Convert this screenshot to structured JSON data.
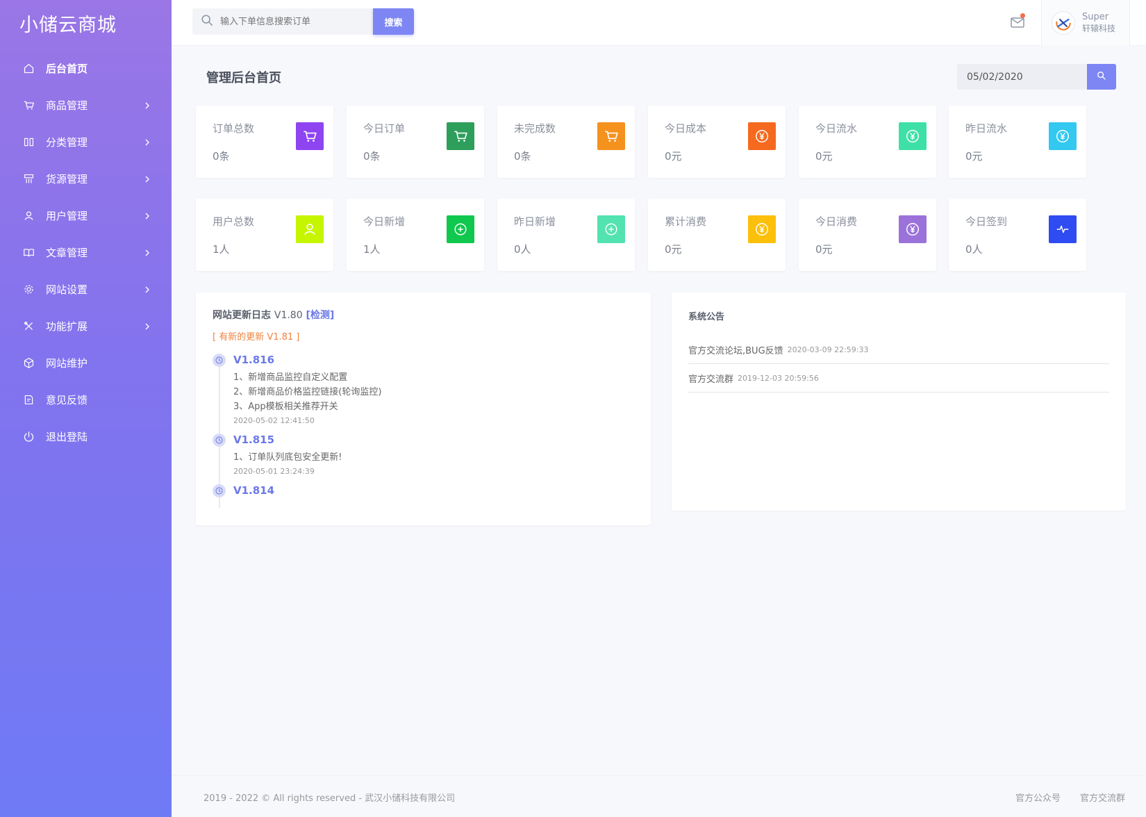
{
  "sidebar": {
    "brand": "小储云商城",
    "items": [
      {
        "label": "后台首页",
        "icon": "home-icon",
        "chevron": false
      },
      {
        "label": "商品管理",
        "icon": "cart-icon",
        "chevron": true
      },
      {
        "label": "分类管理",
        "icon": "columns-icon",
        "chevron": true
      },
      {
        "label": "货源管理",
        "icon": "grid-icon",
        "chevron": true
      },
      {
        "label": "用户管理",
        "icon": "user-icon",
        "chevron": true
      },
      {
        "label": "文章管理",
        "icon": "book-icon",
        "chevron": true
      },
      {
        "label": "网站设置",
        "icon": "gear-icon",
        "chevron": true
      },
      {
        "label": "功能扩展",
        "icon": "tools-icon",
        "chevron": true
      },
      {
        "label": "网站维护",
        "icon": "cube-icon",
        "chevron": false
      },
      {
        "label": "意见反馈",
        "icon": "feedback-icon",
        "chevron": false
      },
      {
        "label": "退出登陆",
        "icon": "power-icon",
        "chevron": false
      }
    ]
  },
  "header": {
    "search_placeholder": "输入下单信息搜索订单",
    "search_button": "搜索",
    "user_name": "Super",
    "user_org": "轩辕科技"
  },
  "main": {
    "title": "管理后台首页",
    "date": "05/02/2020",
    "stats": [
      {
        "label": "订单总数",
        "value": "0条",
        "icon": "cart-icon",
        "color": "#8e44f0"
      },
      {
        "label": "今日订单",
        "value": "0条",
        "icon": "cart-icon",
        "color": "#2e9e5b"
      },
      {
        "label": "未完成数",
        "value": "0条",
        "icon": "cart-icon",
        "color": "#f5921e"
      },
      {
        "label": "今日成本",
        "value": "0元",
        "icon": "yen-icon",
        "color": "#f56a1f"
      },
      {
        "label": "今日流水",
        "value": "0元",
        "icon": "yen-icon",
        "color": "#3fe0a8"
      },
      {
        "label": "昨日流水",
        "value": "0元",
        "icon": "yen-icon",
        "color": "#32c8f0"
      },
      {
        "label": "用户总数",
        "value": "1人",
        "icon": "user-icon",
        "color": "#c6f500"
      },
      {
        "label": "今日新增",
        "value": "1人",
        "icon": "plus-circle-icon",
        "color": "#0fc84d"
      },
      {
        "label": "昨日新增",
        "value": "0人",
        "icon": "plus-circle-icon",
        "color": "#52e3b0"
      },
      {
        "label": "累计消费",
        "value": "0元",
        "icon": "yen-icon",
        "color": "#fcbf0a"
      },
      {
        "label": "今日消费",
        "value": "0元",
        "icon": "yen-icon",
        "color": "#9b72d9"
      },
      {
        "label": "今日签到",
        "value": "0人",
        "icon": "pulse-icon",
        "color": "#2f4bf2"
      }
    ],
    "log": {
      "title": "网站更新日志",
      "version": "V1.80",
      "check": "[检测]",
      "new_update": "[ 有新的更新 V1.81 ]",
      "entries": [
        {
          "version": "V1.816",
          "lines": [
            "1、新增商品监控自定义配置",
            "2、新增商品价格监控链接(轮询监控)",
            "3、App模板相关推荐开关"
          ],
          "time": "2020-05-02 12:41:50"
        },
        {
          "version": "V1.815",
          "lines": [
            "1、订单队列底包安全更新!"
          ],
          "time": "2020-05-01 23:24:39"
        },
        {
          "version": "V1.814",
          "lines": [],
          "time": ""
        }
      ]
    },
    "notice": {
      "title": "系统公告",
      "items": [
        {
          "text": "官方交流论坛,BUG反馈",
          "time": "2020-03-09 22:59:33"
        },
        {
          "text": "官方交流群",
          "time": "2019-12-03 20:59:56"
        }
      ]
    }
  },
  "footer": {
    "copyright": "2019 - 2022 © All rights reserved - 武汉小储科技有限公司",
    "link1": "官方公众号",
    "link2": "官方交流群"
  }
}
